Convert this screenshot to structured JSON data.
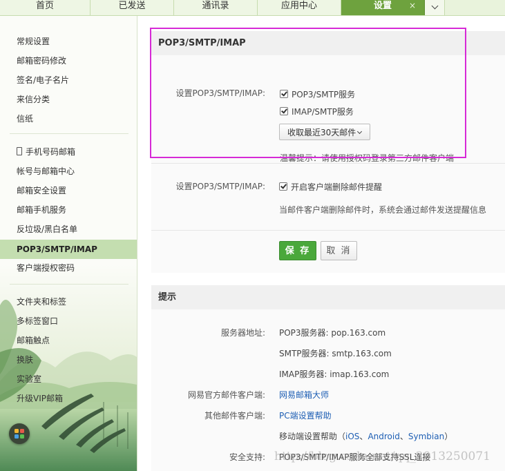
{
  "tabs": [
    {
      "label": "首页"
    },
    {
      "label": "已发送"
    },
    {
      "label": "通讯录"
    },
    {
      "label": "应用中心"
    },
    {
      "label": "设置",
      "close": "×"
    }
  ],
  "sidebar": {
    "group1": [
      {
        "label": "常规设置"
      },
      {
        "label": "邮箱密码修改"
      },
      {
        "label": "签名/电子名片"
      },
      {
        "label": "来信分类"
      },
      {
        "label": "信纸"
      }
    ],
    "group2": [
      {
        "label": "手机号码邮箱"
      },
      {
        "label": "帐号与邮箱中心"
      },
      {
        "label": "邮箱安全设置"
      },
      {
        "label": "邮箱手机服务"
      },
      {
        "label": "反垃圾/黑白名单"
      },
      {
        "label": "POP3/SMTP/IMAP"
      },
      {
        "label": "客户端授权密码"
      }
    ],
    "group3": [
      {
        "label": "文件夹和标签"
      },
      {
        "label": "多标签窗口"
      },
      {
        "label": "邮箱触点"
      },
      {
        "label": "换肤"
      },
      {
        "label": "实验室"
      },
      {
        "label": "升级VIP邮箱"
      }
    ],
    "active_index": 5
  },
  "pop_panel": {
    "title": "POP3/SMTP/IMAP",
    "label1": "设置POP3/SMTP/IMAP:",
    "opt_pop3": "POP3/SMTP服务",
    "opt_imap": "IMAP/SMTP服务",
    "select_value": "收取最近30天邮件",
    "tip": "温馨提示：请使用授权码登录第三方邮件客户端",
    "label2": "设置POP3/SMTP/IMAP:",
    "opt_delete_notice": "开启客户端删除邮件提醒",
    "delete_desc": "当邮件客户端删除邮件时，系统会通过邮件发送提醒信息",
    "save": "保 存",
    "cancel": "取 消"
  },
  "tips_panel": {
    "title": "提示",
    "server_label": "服务器地址:",
    "pop3_server": "POP3服务器: pop.163.com",
    "smtp_server": "SMTP服务器: smtp.163.com",
    "imap_server": "IMAP服务器: imap.163.com",
    "official_client_label": "网易官方邮件客户端:",
    "official_client_link": "网易邮箱大师",
    "other_client_label": "其他邮件客户端:",
    "pc_help_link": "PC端设置帮助",
    "mobile_help_prefix": "移动端设置帮助（",
    "mobile_ios": "iOS",
    "sep1": "、",
    "mobile_android": "Android",
    "sep2": "、",
    "mobile_symbian": "Symbian",
    "mobile_help_suffix": "）",
    "security_label": "安全支持:",
    "security_value": "POP3/SMTP/IMAP服务全部支持SSL连接"
  },
  "watermark": "http://blog.csdn.net/qq_2013250071",
  "colors": {
    "accent_green": "#6ea23e",
    "save_green": "#4aa83b",
    "highlight_magenta": "#d629d6",
    "link_blue": "#1e5fb4"
  }
}
